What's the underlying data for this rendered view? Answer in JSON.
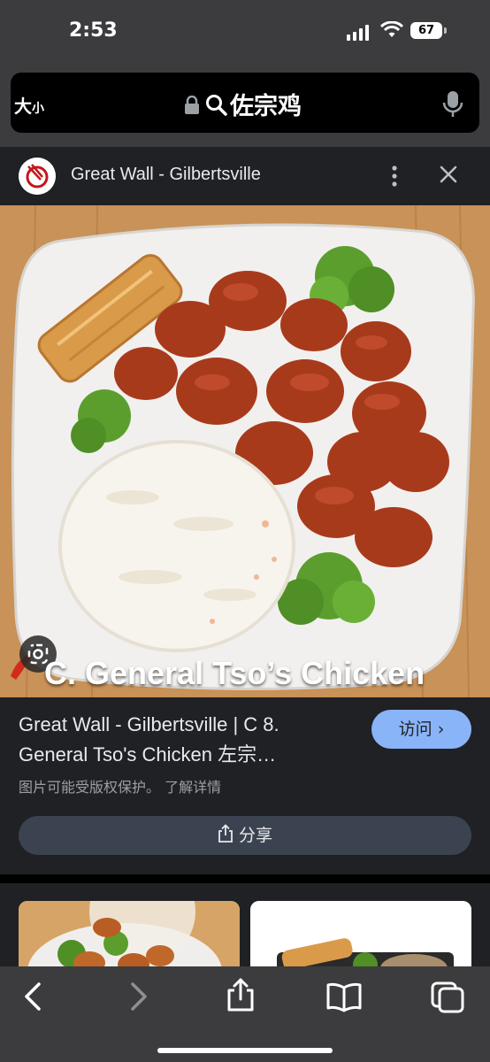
{
  "status_bar": {
    "time": "2:53",
    "battery": "67"
  },
  "address_bar": {
    "text_size_label": "大",
    "text_size_small": "小",
    "query": "佐宗鸡"
  },
  "source": {
    "title": "Great Wall - Gilbertsville"
  },
  "image": {
    "caption": "C.  General Tso’s Chicken"
  },
  "result": {
    "title_line1": "Great Wall - Gilbertsville | C 8.",
    "title_line2": "General Tso's Chicken 左宗…",
    "visit_label": "访问 ›",
    "copyright_text": "图片可能受版权保护。 了解详情",
    "share_label": "分享"
  },
  "colors": {
    "background": "#202124",
    "chrome": "#3c3c3e",
    "visit_button": "#8ab4f8",
    "share_button": "#3c4350"
  },
  "toolbar": {
    "icons": [
      "back-icon",
      "forward-icon",
      "share-icon",
      "bookmarks-icon",
      "tabs-icon"
    ]
  }
}
